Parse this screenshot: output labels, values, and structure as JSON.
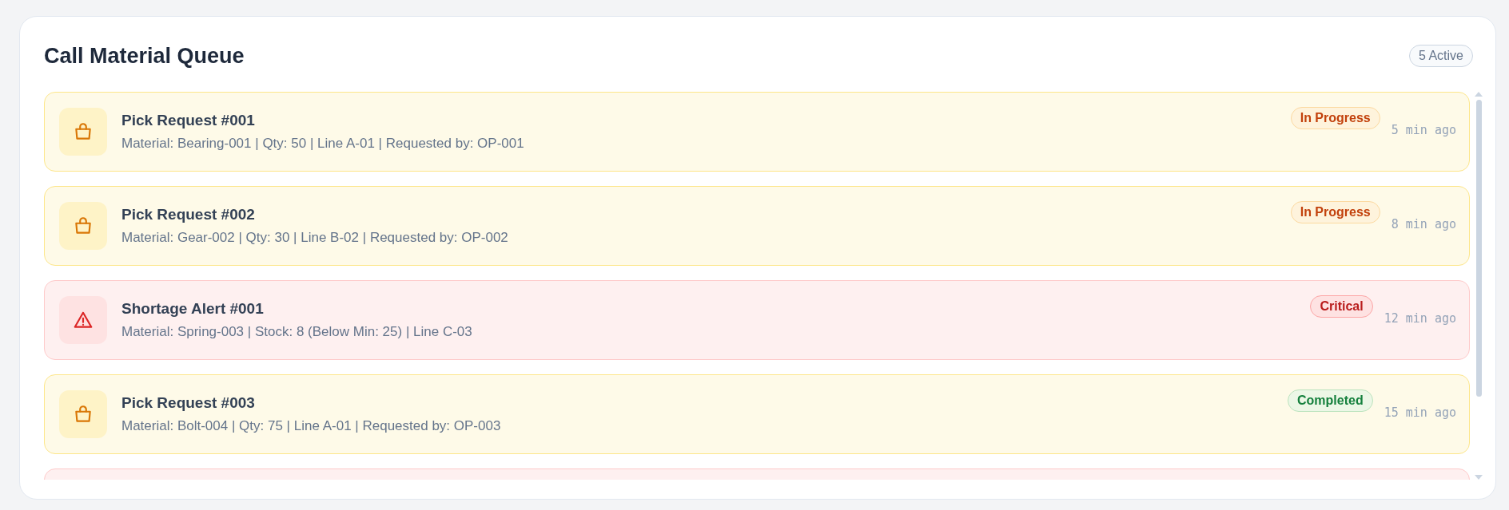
{
  "panel": {
    "title": "Call Material Queue",
    "count_badge": "5 Active"
  },
  "items": [
    {
      "kind": "pick",
      "title": "Pick Request #001",
      "details": "Material: Bearing-001 | Qty: 50 | Line A-01 | Requested by: OP-001",
      "status": {
        "text": "In Progress",
        "kind": "progress"
      },
      "time": "5 min ago"
    },
    {
      "kind": "pick",
      "title": "Pick Request #002",
      "details": "Material: Gear-002 | Qty: 30 | Line B-02 | Requested by: OP-002",
      "status": {
        "text": "In Progress",
        "kind": "progress"
      },
      "time": "8 min ago"
    },
    {
      "kind": "alert",
      "title": "Shortage Alert #001",
      "details": "Material: Spring-003 | Stock: 8 (Below Min: 25) | Line C-03",
      "status": {
        "text": "Critical",
        "kind": "critical"
      },
      "time": "12 min ago"
    },
    {
      "kind": "pick",
      "title": "Pick Request #003",
      "details": "Material: Bolt-004 | Qty: 75 | Line A-01 | Requested by: OP-003",
      "status": {
        "text": "Completed",
        "kind": "completed"
      },
      "time": "15 min ago"
    },
    {
      "kind": "alert"
    }
  ]
}
